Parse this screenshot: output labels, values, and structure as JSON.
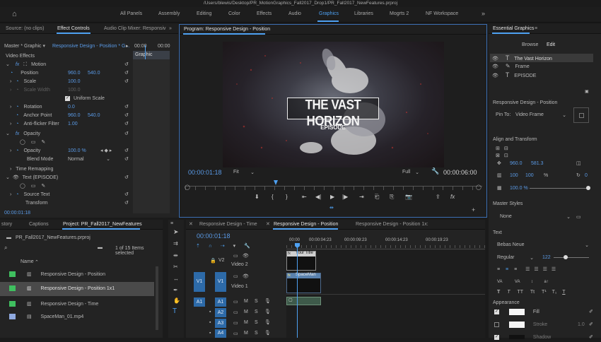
{
  "window": {
    "title": "/Users/blewis/Desktop/PR_MotionGraphics_Fall2017_Drop1/PR_Fall2017_NewFeatures.prproj"
  },
  "workspaces": [
    "All Panels",
    "Assembly",
    "Editing",
    "Color",
    "Effects",
    "Audio",
    "Graphics",
    "Libraries",
    "Mogrts 2",
    "NF Workspace"
  ],
  "active_workspace": "Graphics",
  "source_tabs": [
    "Source: (no clips)",
    "Effect Controls",
    "Audio Clip Mixer: Responsiv"
  ],
  "effect_controls": {
    "master": "Master * Graphic",
    "clip": "Responsive Design - Position * G...",
    "time1": "00:00",
    "time2": "00:00",
    "clip_label": "Graphic",
    "section": "Video Effects",
    "motion": "Motion",
    "position_label": "Position",
    "pos_x": "960.0",
    "pos_y": "540.0",
    "scale_label": "Scale",
    "scale_val": "100.0",
    "scale_width_label": "Scale Width",
    "scale_width_val": "100.0",
    "uniform_scale": "Uniform Scale",
    "rotation_label": "Rotation",
    "rotation_val": "0.0",
    "anchor_label": "Anchor Point",
    "anchor_x": "960.0",
    "anchor_y": "540.0",
    "flicker_label": "Anti-flicker Filter",
    "flicker_val": "1.00",
    "opacity": "Opacity",
    "opacity_label": "Opacity",
    "opacity_val": "100.0 %",
    "blend_label": "Blend Mode",
    "blend_val": "Normal",
    "time_remap": "Time Remapping",
    "text_layer": "Text (EPISODE)",
    "source_text": "Source Text",
    "transform": "Transform",
    "timecode": "00:00:01:18"
  },
  "program": {
    "title": "Program: Responsive Design - Position",
    "headline": "THE VAST HORIZON",
    "subline": "EPISODE",
    "timecode": "00:00:01:18",
    "fit": "Fit",
    "quality": "Full",
    "duration": "00:00:06:00"
  },
  "essential_graphics": {
    "title": "Essential Graphics",
    "tabs": [
      "Browse",
      "Edit"
    ],
    "layers": [
      "The Vast Horizon",
      "Frame",
      "EPISODE"
    ],
    "responsive_title": "Responsive Design - Position",
    "pin_label": "Pin To:",
    "pin_val": "Video Frame",
    "align_title": "Align and Transform",
    "pos_x": "960.0",
    "pos_y": "581.3",
    "scale_w": "100",
    "scale_h": "100",
    "scale_unit": "%",
    "rotation": "0",
    "opacity": "100.0 %",
    "master_styles": "Master Styles",
    "style_val": "None",
    "text_title": "Text",
    "font": "Bebas Neue",
    "weight": "Regular",
    "size": "122",
    "appearance": "Appearance",
    "fill": "Fill",
    "stroke": "Stroke",
    "stroke_val": "1.0",
    "shadow": "Shadow"
  },
  "project": {
    "tabs": [
      "story",
      "Captions",
      "Project: PR_Fall2017_NewFeatures"
    ],
    "file": "PR_Fall2017_NewFeatures.prproj",
    "count": "1 of 15 Items selected",
    "name_col": "Name",
    "items": [
      {
        "name": "Responsive Design - Position",
        "color": "#3fbf5f"
      },
      {
        "name": "Responsive Design - Position 1x1",
        "color": "#3fbf5f"
      },
      {
        "name": "Responsive Design - Time",
        "color": "#3fbf5f"
      },
      {
        "name": "SpaceMan_01.mp4",
        "color": "#8fa9e0"
      }
    ]
  },
  "timeline": {
    "tabs": [
      "Responsive Design - Time",
      "Responsive Design - Position",
      "Responsive Design - Position 1x:"
    ],
    "timecode": "00:00:01:18",
    "ruler": [
      "00:00",
      "00:00:04:23",
      "00:00:09:23",
      "00:00:14:23",
      "00:00:19:23"
    ],
    "v2": "V2",
    "v2_name": "Video 2",
    "v1": "V1",
    "v1_name": "Video 1",
    "a_tracks": [
      "A1",
      "A2",
      "A3",
      "A4"
    ],
    "clip_title": "Your Title",
    "clip_spaceman": "SpaceMan"
  }
}
